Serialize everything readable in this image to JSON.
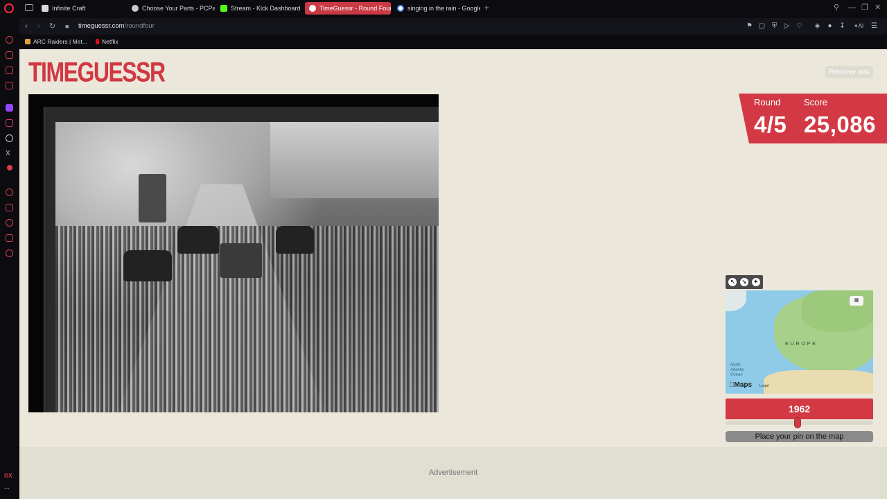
{
  "browser": {
    "tabs": [
      {
        "label": "Infinite Craft",
        "active": false
      },
      {
        "label": "Choose Your Parts - PCPa",
        "active": false
      },
      {
        "label": "Stream - Kick Dashboard",
        "active": false
      },
      {
        "label": "TimeGuessr - Round Four",
        "active": true
      },
      {
        "label": "singing in the rain - Google",
        "active": false
      }
    ],
    "url_host": "timeguessr.com",
    "url_path": "/roundfour",
    "bookmarks": [
      {
        "label": "ARC Raiders | Met..."
      },
      {
        "label": "Netflix"
      }
    ],
    "sidebar_bottom_label": "GX"
  },
  "page": {
    "logo_text": "TIMEGUESSR",
    "remove_ads_label": "Remove ads",
    "score_card": {
      "round_label": "Round",
      "round_value": "4/5",
      "score_label": "Score",
      "score_value": "25,086"
    },
    "map": {
      "region_label": "EUROPE",
      "ocean_label_1": "North",
      "ocean_label_2": "Atlantic",
      "ocean_label_3": "Ocean",
      "maps_brand": "Maps",
      "legal_label": "Legal"
    },
    "year_value": "1962",
    "year_slider_fraction": 0.49,
    "pin_button_label": "Place your pin on the map",
    "advertisement_label": "Advertisement"
  },
  "colors": {
    "accent": "#d33944",
    "page_bg": "#ebe7da",
    "active_tab": "#c93a45"
  }
}
